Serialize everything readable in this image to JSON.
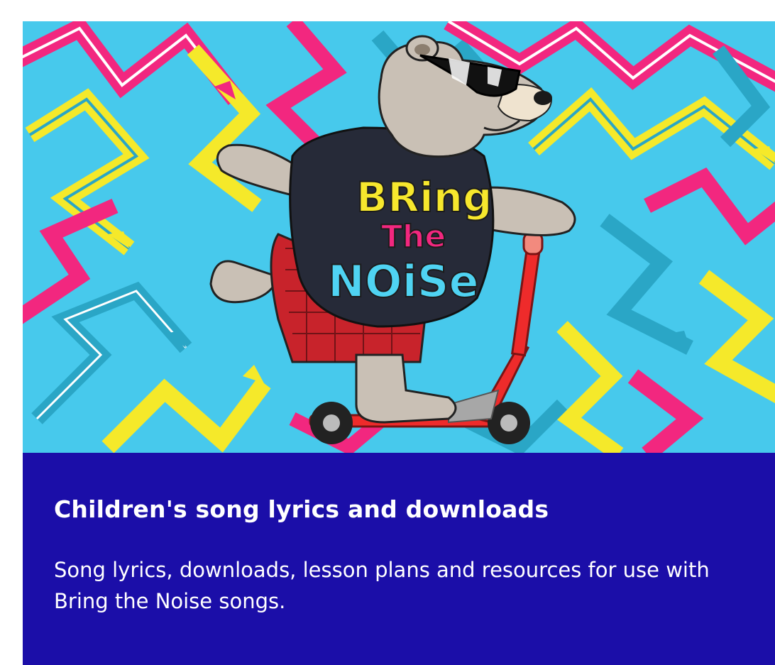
{
  "card": {
    "title": "Children's song lyrics and downloads",
    "description": "Song lyrics, downloads, lesson plans and resources for use with Bring the Noise songs."
  },
  "hero": {
    "shirt_logo_line1": "BRing",
    "shirt_logo_line2": "The",
    "shirt_logo_line3": "NOiSe",
    "character": "bear-on-scooter",
    "background_pattern": "zigzag-arrows"
  },
  "colors": {
    "panel_bg": "#1b0ea8",
    "panel_text": "#ffffff",
    "hero_bg": "#47c9ec",
    "arrow_pink": "#f2277f",
    "arrow_yellow": "#f5e92a",
    "arrow_teal": "#2aa6c6",
    "logo_yellow": "#f6e72d",
    "logo_pink": "#f2277f",
    "logo_cyan": "#4fd3f2",
    "scooter_red": "#ee2b2b"
  }
}
